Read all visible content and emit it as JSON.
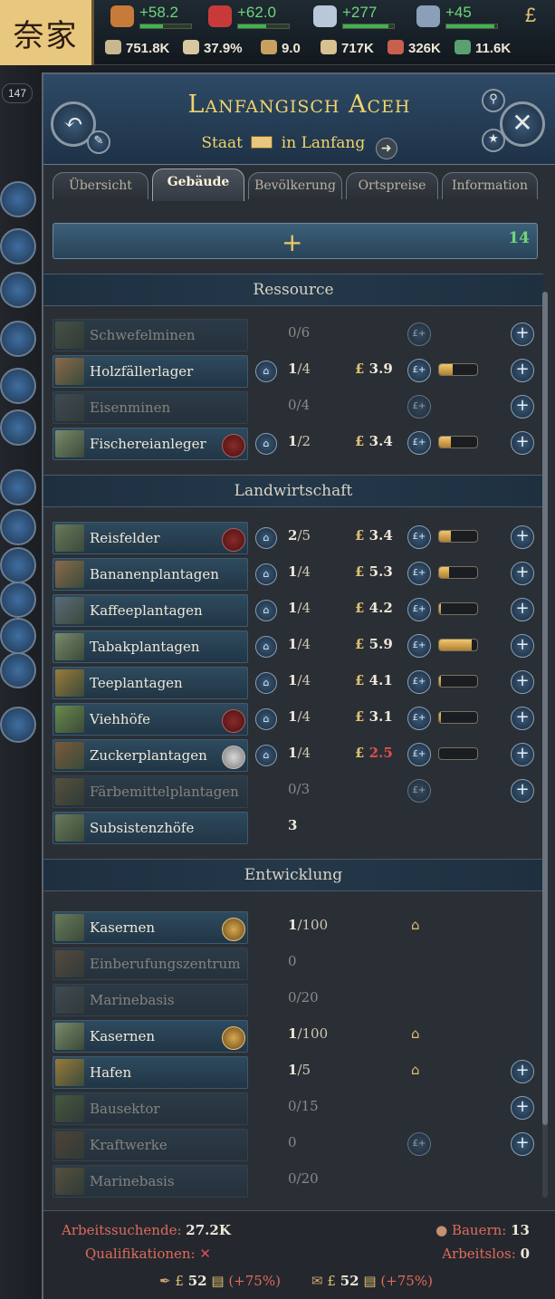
{
  "topbar": {
    "flag_text": "奈家",
    "resources": [
      {
        "icon": "legitimacy-icon",
        "value": "+58.2",
        "fill": 0.45
      },
      {
        "icon": "influence-icon",
        "value": "+62.0",
        "fill": 0.55
      },
      {
        "icon": "dove-icon",
        "value": "+277",
        "fill": 0.9
      },
      {
        "icon": "ship-icon",
        "value": "+45",
        "fill": 0.95
      },
      {
        "icon": "pound-icon",
        "value": "£"
      }
    ],
    "stats": [
      {
        "icon": "gdp-icon",
        "value": "751.8K"
      },
      {
        "icon": "literacy-icon",
        "value": "37.9%"
      },
      {
        "icon": "wheat-icon",
        "value": "9.0"
      },
      {
        "icon": "population-icon",
        "value": "717K"
      },
      {
        "icon": "fist-icon",
        "value": "326K"
      },
      {
        "icon": "heart-icon",
        "value": "11.6K"
      }
    ],
    "day_count": "147"
  },
  "panel": {
    "title": "Lanfangisch Aceh",
    "subtitle_prefix": "Staat",
    "subtitle_suffix": "in Lanfang",
    "tabs": [
      "Übersicht",
      "Gebäude",
      "Bevölkerung",
      "Ortspreise",
      "Information"
    ],
    "active_tab": "Gebäude",
    "add_count": "14"
  },
  "sections": [
    {
      "title": "Ressource"
    },
    {
      "title": "Landwirtschaft"
    },
    {
      "title": "Entwicklung"
    }
  ],
  "buildings": {
    "ressource": [
      {
        "name": "Schwefelminen",
        "level": "0",
        "max": "/6",
        "price": "",
        "progress": 0,
        "dim": true
      },
      {
        "name": "Holzfällerlager",
        "level": "1",
        "max": "/4",
        "price": "3.9",
        "progress": 0.35
      },
      {
        "name": "Eisenminen",
        "level": "0",
        "max": "/4",
        "price": "",
        "progress": 0,
        "dim": true
      },
      {
        "name": "Fischereianleger",
        "level": "1",
        "max": "/2",
        "price": "3.4",
        "progress": 0.3
      }
    ],
    "landwirtschaft": [
      {
        "name": "Reisfelder",
        "level": "2",
        "max": "/5",
        "price": "3.4",
        "progress": 0.3
      },
      {
        "name": "Bananenplantagen",
        "level": "1",
        "max": "/4",
        "price": "5.3",
        "progress": 0.25
      },
      {
        "name": "Kaffeeplantagen",
        "level": "1",
        "max": "/4",
        "price": "4.2",
        "progress": 0.05
      },
      {
        "name": "Tabakplantagen",
        "level": "1",
        "max": "/4",
        "price": "5.9",
        "progress": 0.85
      },
      {
        "name": "Teeplantagen",
        "level": "1",
        "max": "/4",
        "price": "4.1",
        "progress": 0.05
      },
      {
        "name": "Viehhöfe",
        "level": "1",
        "max": "/4",
        "price": "3.1",
        "progress": 0.05
      },
      {
        "name": "Zuckerplantagen",
        "level": "1",
        "max": "/4",
        "price": "2.5",
        "progress": 0
      },
      {
        "name": "Färbemittelplantagen",
        "level": "0",
        "max": "/3",
        "price": "",
        "progress": 0,
        "dim": true
      },
      {
        "name": "Subsistenzhöfe",
        "level": "3",
        "max": "",
        "price": ""
      }
    ],
    "entwicklung": [
      {
        "name": "Kasernen",
        "level": "1",
        "max": "/100"
      },
      {
        "name": "Einberufungszentrum",
        "level": "0",
        "max": "",
        "dim": true
      },
      {
        "name": "Marinebasis",
        "level": "0",
        "max": "/20",
        "dim": true
      },
      {
        "name": "Kasernen",
        "level": "1",
        "max": "/100"
      },
      {
        "name": "Hafen",
        "level": "1",
        "max": "/5"
      },
      {
        "name": "Bausektor",
        "level": "0",
        "max": "/15",
        "dim": true
      },
      {
        "name": "Kraftwerke",
        "level": "0",
        "max": "",
        "dim": true
      },
      {
        "name": "Marinebasis",
        "level": "0",
        "max": "/20",
        "dim": true
      }
    ]
  },
  "footer": {
    "jobseekers_label": "Arbeitssuchende:",
    "jobseekers_value": "27.2K",
    "qualifications_label": "Qualifikationen:",
    "peasants_label": "Bauern:",
    "peasants_value": "13",
    "unemployed_label": "Arbeitslos:",
    "unemployed_value": "0",
    "cost1": "52",
    "mod1": "(+75%)",
    "cost2": "52",
    "mod2": "(+75%)"
  },
  "colors": {
    "accent_gold": "#f1d46a",
    "positive": "#6ed67a",
    "negative": "#e05050"
  }
}
